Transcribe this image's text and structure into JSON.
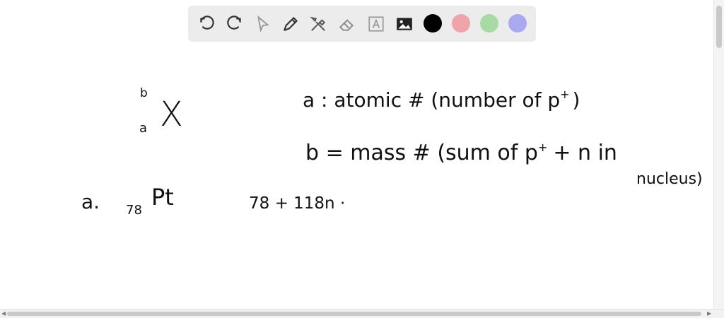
{
  "toolbar": {
    "tools": [
      "undo-icon",
      "redo-icon",
      "select-icon",
      "pen-icon",
      "tools-icon",
      "eraser-icon",
      "text-icon",
      "image-icon"
    ],
    "colors": [
      "#000000",
      "#f0a3a8",
      "#a6dba4",
      "#a9a9ef"
    ]
  },
  "board": {
    "notation_top": "b",
    "notation_bottom": "a",
    "notation_symbol": "X",
    "def_a": "a : atomic # (number of p",
    "def_a_sup": "+",
    "def_a_close": ")",
    "def_b": "b = mass # (sum of p",
    "def_b_sup": "+",
    "def_b_rest": "+ n in",
    "def_b_cont": "nucleus)",
    "item_label": "a.",
    "item_sub": "78",
    "item_symbol": "Pt",
    "item_calc": "78 + 118n ·"
  }
}
